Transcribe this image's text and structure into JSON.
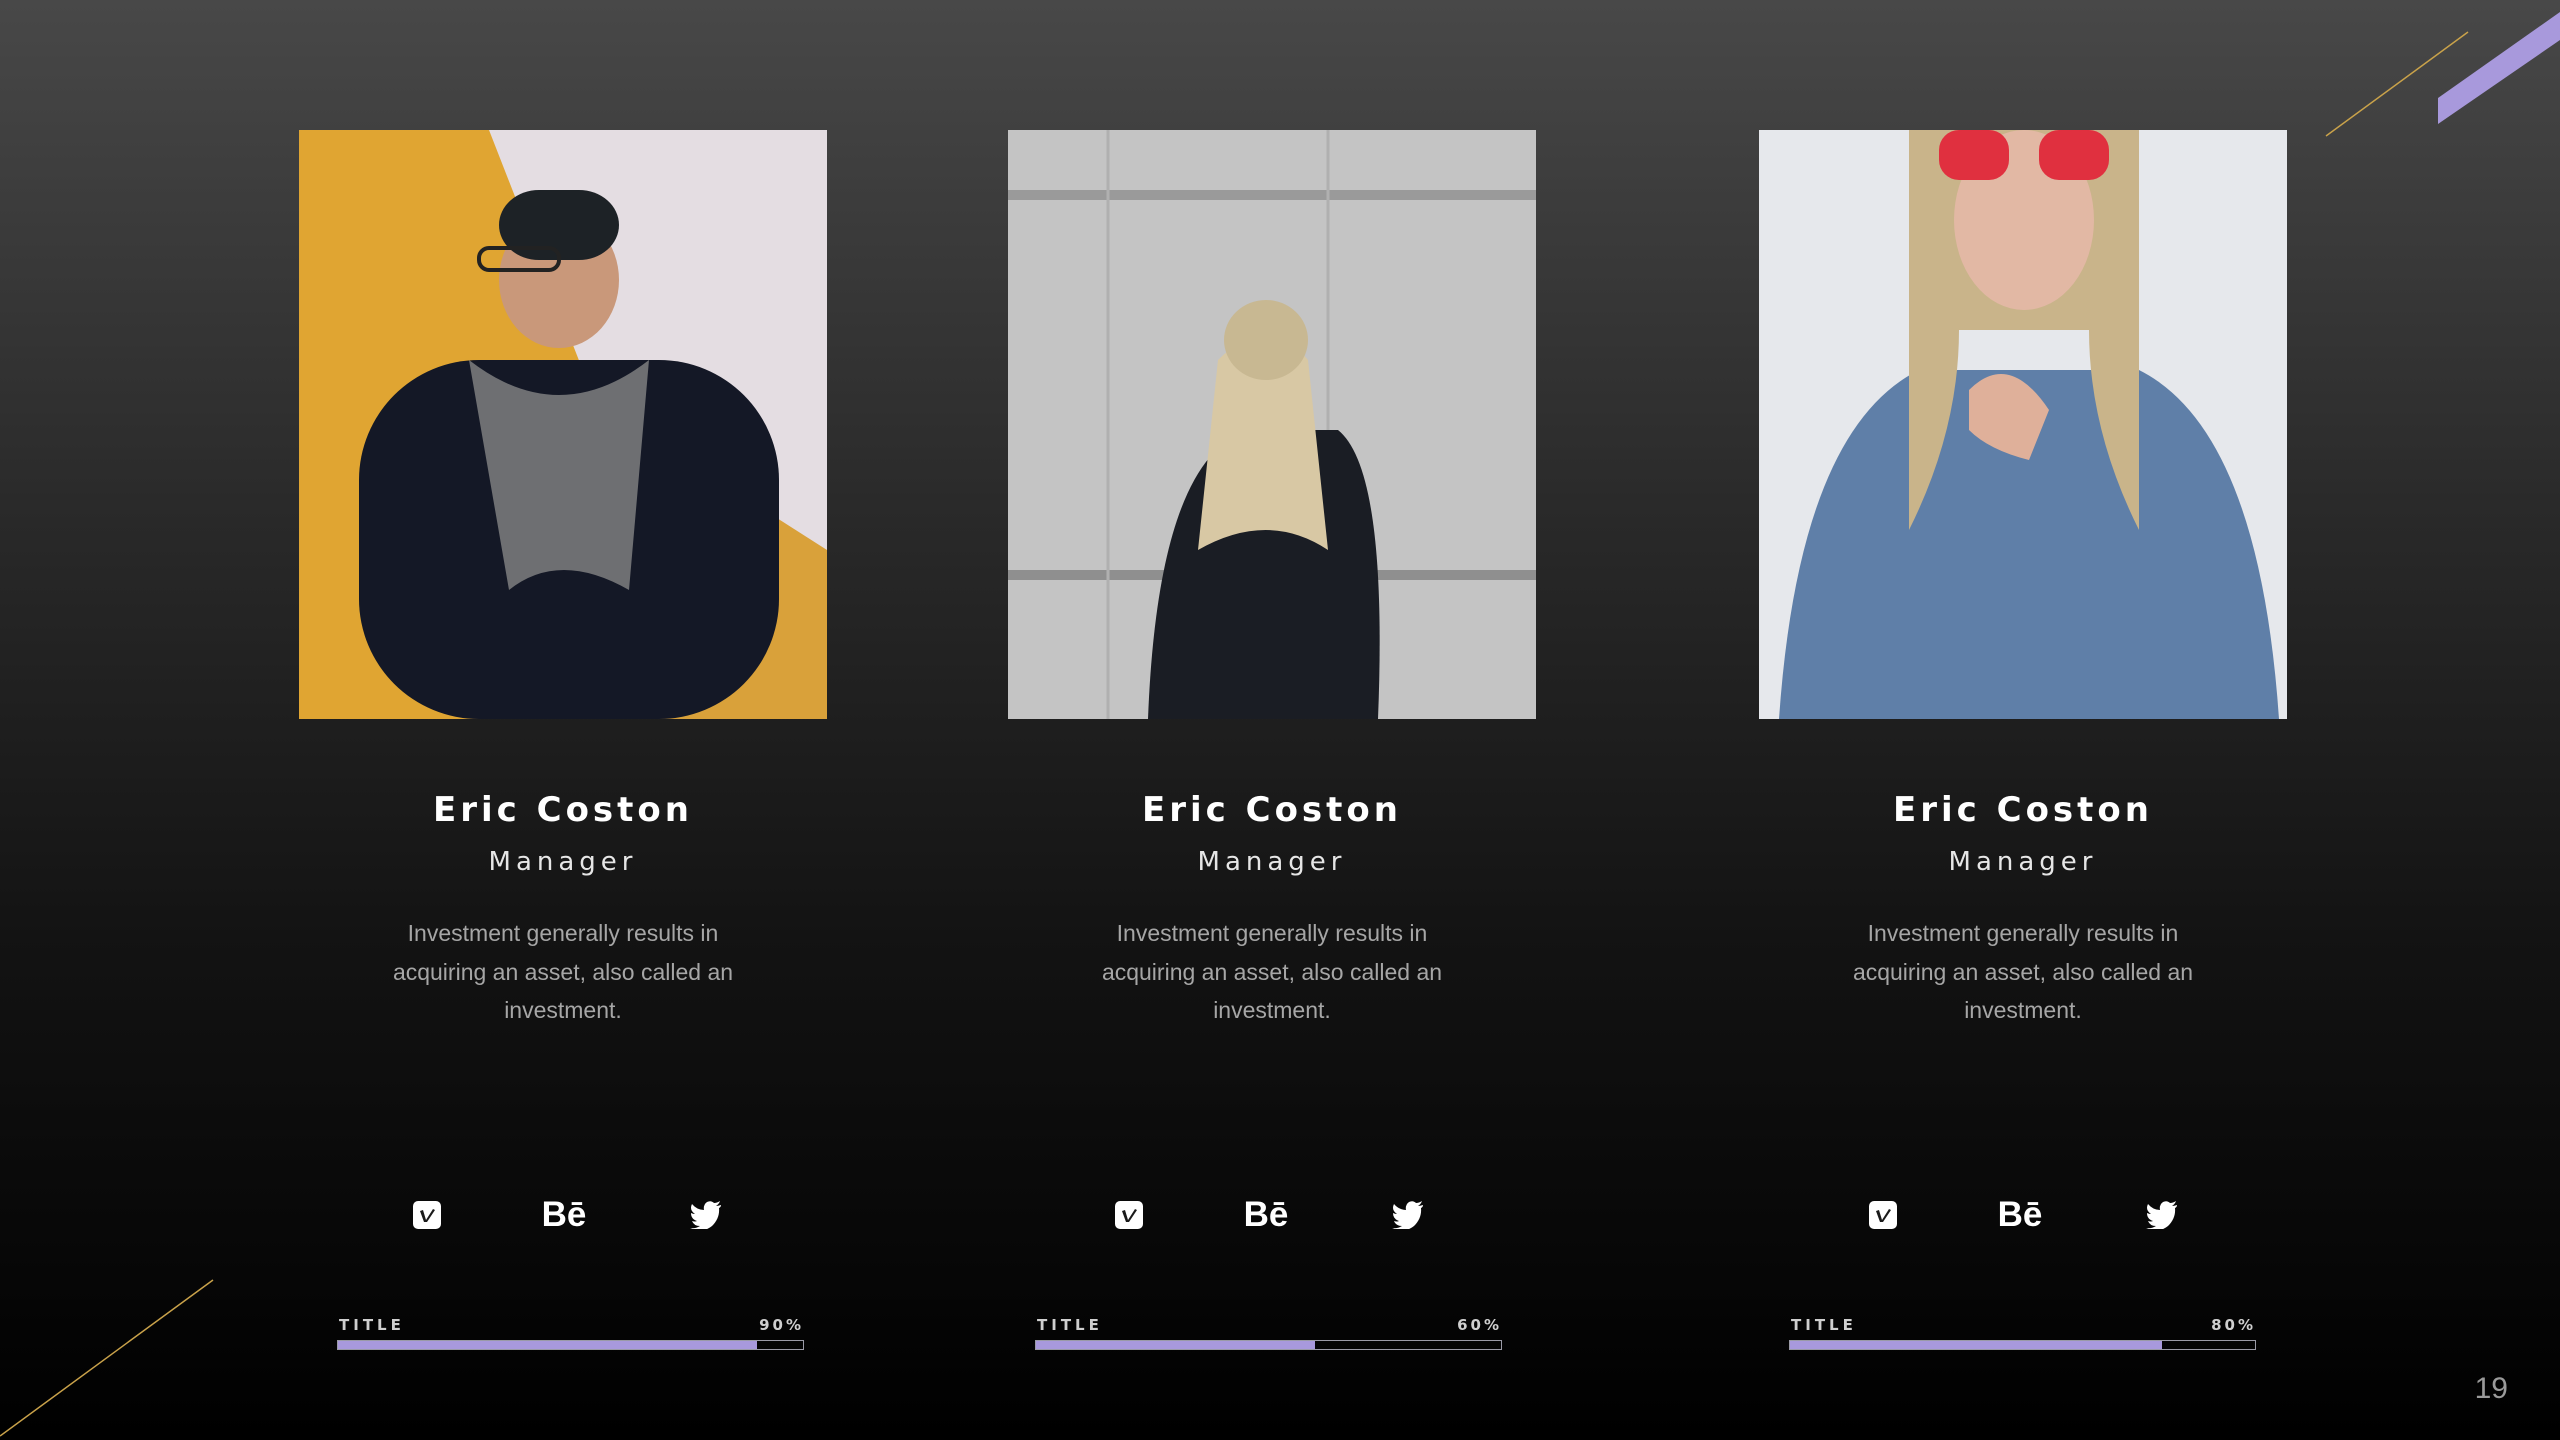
{
  "colors": {
    "accent": "#a899dc",
    "gold_line": "#c9a24a",
    "background_top": "#484848",
    "background_bottom": "#000000"
  },
  "page_number": "19",
  "members": [
    {
      "name": "Eric Coston",
      "role": "Manager",
      "description": "Investment generally results in acquiring an asset, also called an investment.",
      "socials": [
        "vimeo-icon",
        "behance-icon",
        "twitter-icon"
      ],
      "behance_text": "Bē",
      "skill": {
        "label": "TITLE",
        "value_text": "90%",
        "value": 0.9
      }
    },
    {
      "name": "Eric Coston",
      "role": "Manager",
      "description": "Investment generally results in acquiring an asset, also called an investment.",
      "socials": [
        "vimeo-icon",
        "behance-icon",
        "twitter-icon"
      ],
      "behance_text": "Bē",
      "skill": {
        "label": "TITLE",
        "value_text": "60%",
        "value": 0.6
      }
    },
    {
      "name": "Eric Coston",
      "role": "Manager",
      "description": "Investment generally results in acquiring an asset, also called an investment.",
      "socials": [
        "vimeo-icon",
        "behance-icon",
        "twitter-icon"
      ],
      "behance_text": "Bē",
      "skill": {
        "label": "TITLE",
        "value_text": "80%",
        "value": 0.8
      }
    }
  ]
}
